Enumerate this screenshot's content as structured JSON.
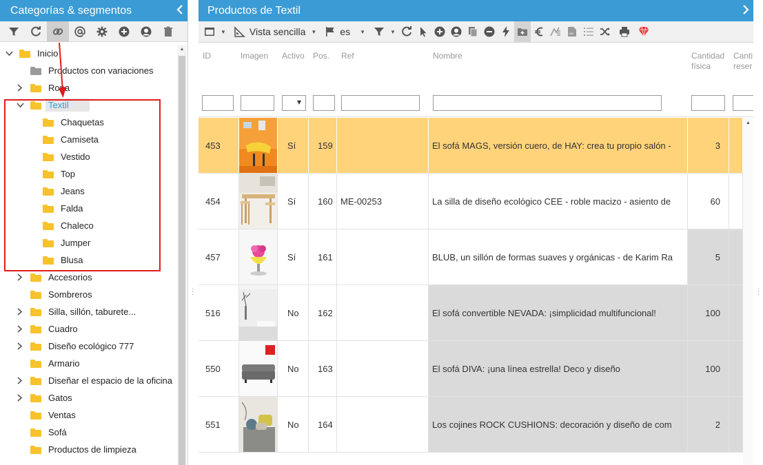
{
  "left_panel": {
    "title": "Categorías & segmentos",
    "collapse_icon": "chevron-left-icon",
    "toolbar": [
      "filter-icon",
      "refresh-icon",
      "link-icon",
      "at-icon",
      "gear-icon",
      "add-circle-icon",
      "user-avatar-icon",
      "trash-icon"
    ],
    "tree": [
      {
        "label": "Inicio",
        "level": 0,
        "toggle": "expanded",
        "folder": "yellow"
      },
      {
        "label": "Productos con variaciones",
        "level": 1,
        "toggle": "none",
        "folder": "grey"
      },
      {
        "label": "Ropa",
        "level": 1,
        "toggle": "collapsed",
        "folder": "yellow"
      },
      {
        "label": "Textil",
        "level": 1,
        "toggle": "expanded",
        "folder": "yellow",
        "selected": true
      },
      {
        "label": "Chaquetas",
        "level": 2,
        "toggle": "none",
        "folder": "yellow"
      },
      {
        "label": "Camiseta",
        "level": 2,
        "toggle": "none",
        "folder": "yellow"
      },
      {
        "label": "Vestido",
        "level": 2,
        "toggle": "none",
        "folder": "yellow"
      },
      {
        "label": "Top",
        "level": 2,
        "toggle": "none",
        "folder": "yellow"
      },
      {
        "label": "Jeans",
        "level": 2,
        "toggle": "none",
        "folder": "yellow"
      },
      {
        "label": "Falda",
        "level": 2,
        "toggle": "none",
        "folder": "yellow"
      },
      {
        "label": "Chaleco",
        "level": 2,
        "toggle": "none",
        "folder": "yellow"
      },
      {
        "label": "Jumper",
        "level": 2,
        "toggle": "none",
        "folder": "yellow"
      },
      {
        "label": "Blusa",
        "level": 2,
        "toggle": "none",
        "folder": "yellow"
      },
      {
        "label": "Accesorios",
        "level": 1,
        "toggle": "collapsed",
        "folder": "yellow"
      },
      {
        "label": "Sombreros",
        "level": 1,
        "toggle": "none",
        "folder": "yellow"
      },
      {
        "label": "Silla, sillón, taburete...",
        "level": 1,
        "toggle": "collapsed",
        "folder": "yellow"
      },
      {
        "label": "Cuadro",
        "level": 1,
        "toggle": "collapsed",
        "folder": "yellow"
      },
      {
        "label": "Diseño ecológico 777",
        "level": 1,
        "toggle": "collapsed",
        "folder": "yellow"
      },
      {
        "label": "Armario",
        "level": 1,
        "toggle": "none",
        "folder": "yellow"
      },
      {
        "label": "Diseñar el espacio de la oficina",
        "level": 1,
        "toggle": "collapsed",
        "folder": "yellow"
      },
      {
        "label": "Gatos",
        "level": 1,
        "toggle": "collapsed",
        "folder": "yellow"
      },
      {
        "label": "Ventas",
        "level": 1,
        "toggle": "none",
        "folder": "yellow"
      },
      {
        "label": "Sofá",
        "level": 1,
        "toggle": "none",
        "folder": "yellow"
      },
      {
        "label": "Productos de limpieza",
        "level": 1,
        "toggle": "none",
        "folder": "yellow"
      }
    ]
  },
  "right_panel": {
    "title": "Productos de Textil",
    "expand_icon": "chevron-right-icon",
    "toolbar": {
      "view_label": "Vista sencilla",
      "lang_label": "es"
    },
    "columns": [
      "ID",
      "Imagen",
      "Activo",
      "Pos.",
      "Ref",
      "Nombre",
      "Cantidad física",
      "Cantidad reservada"
    ],
    "columns_display": {
      "qty_physical": [
        "Cantidad",
        "física"
      ],
      "qty_reserved": [
        "Canti",
        "reser"
      ]
    },
    "rows": [
      {
        "id": "453",
        "active": "Sí",
        "pos": "159",
        "ref": "",
        "name": "El sofá MAGS, versión cuero, de HAY: crea tu propio salón -",
        "qty": "3",
        "image": "orange-chair"
      },
      {
        "id": "454",
        "active": "Sí",
        "pos": "160",
        "ref": "ME-00253",
        "name": "La silla de diseño ecológico CEE - roble macizo - asiento de",
        "qty": "60",
        "image": "dining-table"
      },
      {
        "id": "457",
        "active": "Sí",
        "pos": "161",
        "ref": "",
        "name": "BLUB, un sillón de formas suaves y orgánicas - de Karim Ra",
        "qty": "5",
        "image": "flower-chair"
      },
      {
        "id": "516",
        "active": "No",
        "pos": "162",
        "ref": "",
        "name": "El sofá convertible NEVADA: ¡simplicidad multifuncional!",
        "qty": "100",
        "image": "white-room"
      },
      {
        "id": "550",
        "active": "No",
        "pos": "163",
        "ref": "",
        "name": "El sofá DIVA: ¡una línea estrella! Deco y diseño",
        "qty": "100",
        "image": "grey-sofa"
      },
      {
        "id": "551",
        "active": "No",
        "pos": "164",
        "ref": "",
        "name": "Los cojines ROCK CUSHIONS: decoración y diseño de com",
        "qty": "2",
        "image": "cushions"
      }
    ]
  },
  "colors": {
    "header_blue": "#3a9bd5",
    "row_highlight": "#ffd37a",
    "inactive_grey": "#dadada",
    "folder_yellow": "#f7c22c",
    "annotation_red": "#e01b1b"
  }
}
